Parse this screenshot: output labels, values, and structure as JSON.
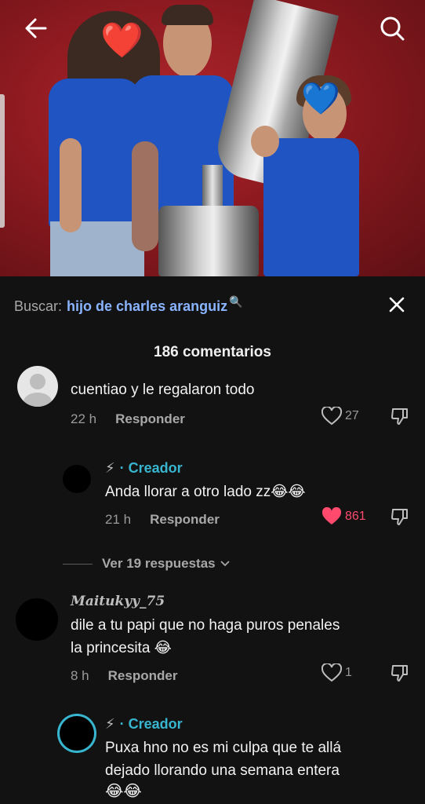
{
  "header": {
    "back_icon": "arrow-left-icon",
    "search_icon": "search-icon"
  },
  "video": {
    "face_emoji_left": "❤️",
    "face_emoji_right": "💙"
  },
  "search": {
    "label": "Buscar:",
    "query": "hijo de charles aranguiz",
    "query_icon": "🔍"
  },
  "comments_title": "186 comentarios",
  "comments": [
    {
      "text": "cuentiao y le regalaron todo",
      "time": "22 h",
      "reply_label": "Responder",
      "likes": "27"
    },
    {
      "creator_icon": "⚡",
      "creator_label": "· Creador",
      "text": "Anda llorar a otro lado zz😂😂",
      "time": "21 h",
      "reply_label": "Responder",
      "likes": "861"
    },
    {
      "username": "Maitukyy_75",
      "text_line1": "dile a tu papi que no haga puros penales",
      "text_line2": "la princesita 😂",
      "time": "8 h",
      "reply_label": "Responder",
      "likes": "1"
    },
    {
      "creator_icon": "⚡",
      "creator_label": "· Creador",
      "text_line1": "Puxa hno no es mi culpa que te allá",
      "text_line2": "dejado llorando una semana entera",
      "text_line3": "😂😂"
    }
  ],
  "view_replies": "Ver 19 respuestas",
  "colors": {
    "accent_blue": "#8ab4ff",
    "creator_teal": "#38b6d0",
    "like_red": "#ff4a6e",
    "background": "#121212"
  }
}
